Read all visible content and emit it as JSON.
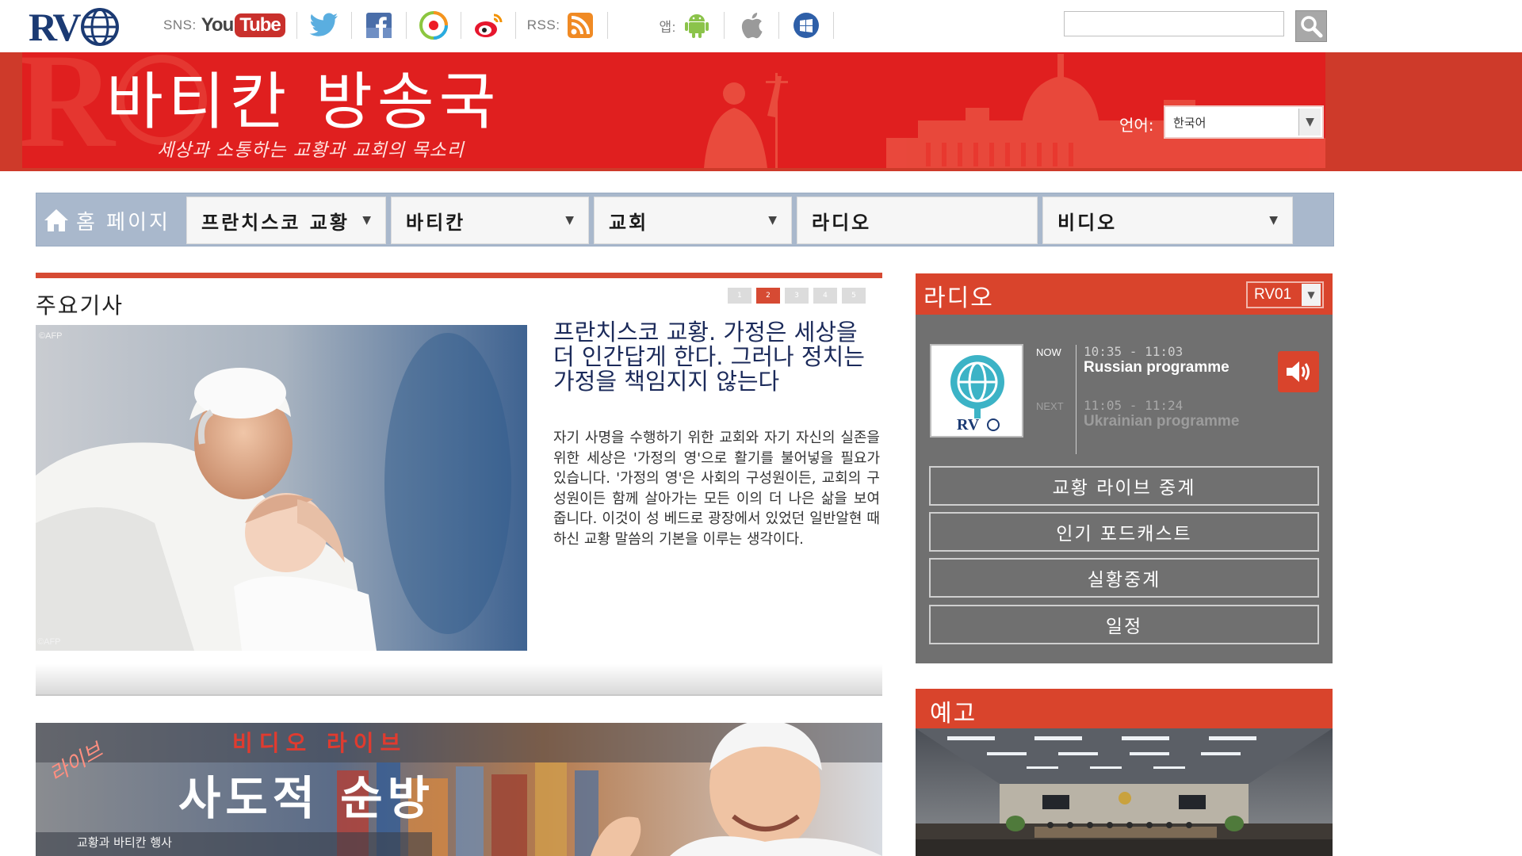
{
  "topbar": {
    "logo_text": "RV",
    "sns_label": "SNS:",
    "youtube": {
      "you": "You",
      "tube": "Tube"
    },
    "rss_label": "RSS:",
    "app_label": "앱:",
    "icons": [
      "youtube-icon",
      "twitter-icon",
      "facebook-icon",
      "weibo-color-icon",
      "sina-weibo-icon",
      "rss-icon",
      "android-icon",
      "apple-icon",
      "windows-icon",
      "search-icon"
    ],
    "search": {
      "value": "",
      "placeholder": ""
    }
  },
  "banner": {
    "title": "바티칸 방송국",
    "subtitle": "세상과 소통하는 교황과 교회의 목소리",
    "lang_label": "언어:",
    "lang_value": "한국어",
    "color": "#e01f1f"
  },
  "nav": {
    "home": "홈 페이지",
    "items": [
      {
        "label": "프란치스코 교황",
        "dropdown": true
      },
      {
        "label": "바티칸",
        "dropdown": true
      },
      {
        "label": "교회",
        "dropdown": true
      },
      {
        "label": "라디오",
        "dropdown": false
      },
      {
        "label": "비디오",
        "dropdown": true
      }
    ]
  },
  "featured": {
    "section_title": "주요기사",
    "pages": [
      "1",
      "2",
      "3",
      "4",
      "5"
    ],
    "active_page": 2,
    "image_credit": "©AFP",
    "headline": "프란치스코 교황. 가정은 세상을 더 인간답게 한다. 그러나 정치는 가정을 책임지지 않는다",
    "body": "자기 사명을 수행하기 위한 교회와 자기 자신의 실존을 위한 세상은 '가정의 영'으로 활기를 불어넣을 필요가 있습니다. '가정의 영'은 사회의 구성원이든, 교회의 구성원이든 함께 살아가는 모든 이의 더 나은 삶을 보여 줍니다. 이것이 성 베드로 광장에서 있었던 일반알현 때 하신 교황 말씀의 기본을 이루는 생각이다."
  },
  "video_banner": {
    "title_top": "비디오 라이브",
    "title_main": "사도적 순방",
    "live_tag": "라이브",
    "caption": "교황과 바티칸 행사"
  },
  "radio": {
    "title": "라디오",
    "channel": "RV01",
    "now_label": "NOW",
    "next_label": "NEXT",
    "now_time": "10:35 - 11:03",
    "now_program": "Russian programme",
    "next_time": "11:05 - 11:24",
    "next_program": "Ukrainian programme",
    "buttons": [
      "교황 라이브 중계",
      "인기 포드캐스트",
      "실황중계",
      "일정"
    ]
  },
  "preview": {
    "title": "예고"
  }
}
